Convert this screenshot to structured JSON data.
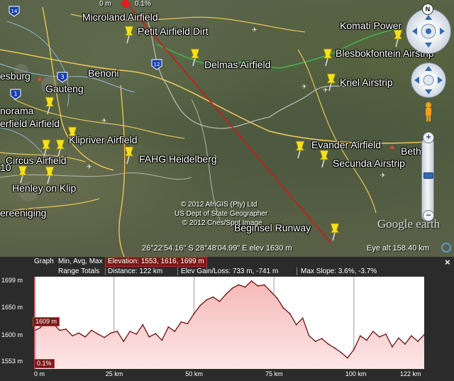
{
  "map": {
    "labels": [
      {
        "id": "microland",
        "text": "Microland Airfield"
      },
      {
        "id": "petit",
        "text": "Petit Airfield Dirt"
      },
      {
        "id": "komati",
        "text": "Komati Power"
      },
      {
        "id": "blesbok",
        "text": "Blesbokfontein Airstrip"
      },
      {
        "id": "delmas",
        "text": "Delmas Airfield"
      },
      {
        "id": "kriel",
        "text": "Kriel Airstrip"
      },
      {
        "id": "esburg",
        "text": "esburg"
      },
      {
        "id": "benoni",
        "text": "Benoni"
      },
      {
        "id": "gauteng",
        "text": "Gauteng"
      },
      {
        "id": "norama",
        "text": "norama"
      },
      {
        "id": "erfield",
        "text": "erfield Airfield"
      },
      {
        "id": "klipriver",
        "text": "Klipriver Airfield"
      },
      {
        "id": "evander",
        "text": "Evander Airfield"
      },
      {
        "id": "bethal",
        "text": "Bethal"
      },
      {
        "id": "circus",
        "text": "Circus Airfield"
      },
      {
        "id": "fahg",
        "text": "FAHG Heidelberg"
      },
      {
        "id": "secunda",
        "text": "Secunda Airstrip"
      },
      {
        "id": "ten",
        "text": "10"
      },
      {
        "id": "henley",
        "text": "Henley on Klip"
      },
      {
        "id": "ereeniging",
        "text": "ereeniging"
      },
      {
        "id": "beginsel",
        "text": "Beginsel Runway"
      }
    ],
    "shields": [
      {
        "id": "s14",
        "text": "14"
      },
      {
        "id": "s3",
        "text": "3"
      },
      {
        "id": "s12",
        "text": "12"
      },
      {
        "id": "s1",
        "text": "1"
      }
    ],
    "cursor_marker": {
      "distance": "0 m",
      "slope": "0.1%"
    },
    "copyright": [
      "© 2012 AfriGIS (Pty) Ltd",
      "US Dept of State Geographer",
      "© 2012 Cnes/Spot Image"
    ],
    "logo": "Google earth",
    "status": {
      "coords": "26°22'54.16\" S   28°48'04.99\" E  elev  1630 m",
      "eye_alt": "Eye alt   158.40 km"
    },
    "north_label": "N"
  },
  "panel": {
    "graph_label": "Graph",
    "graph_mode": "Min, Avg, Max",
    "elevation_label": "Elevation: 1553, 1616, 1699 m",
    "range_totals": "Range Totals",
    "distance": "Distance: 122 km",
    "elev_gain_loss": "Elev Gain/Loss: 733 m, -741 m",
    "max_slope": "Max Slope: 3.6%, -3.7%",
    "close": "×"
  },
  "chart_data": {
    "type": "area",
    "title": "",
    "xlabel": "",
    "ylabel": "",
    "x_unit": "km",
    "y_unit": "m",
    "xlim": [
      0,
      122
    ],
    "ylim": [
      1553,
      1699
    ],
    "y_ticks": [
      "1699 m",
      "1650 m",
      "1600 m",
      "1553 m"
    ],
    "y_tick_values": [
      1699,
      1650,
      1600,
      1553
    ],
    "x_ticks": [
      "0 m",
      "25 km",
      "50 km",
      "75 km",
      "100 km",
      "122 km"
    ],
    "x_tick_values": [
      0,
      25,
      50,
      75,
      100,
      122
    ],
    "cursor": {
      "elevation": "1609 m",
      "slope": "0.1%"
    },
    "series": [
      {
        "x": [
          0,
          2,
          4,
          6,
          8,
          10,
          12,
          14,
          16,
          18,
          20,
          22,
          24,
          26,
          28,
          30,
          32,
          34,
          36,
          38,
          40,
          42,
          44,
          46,
          48,
          50,
          52,
          54,
          56,
          58,
          60,
          62,
          64,
          66,
          68,
          70,
          72,
          74,
          76,
          78,
          80,
          82,
          84,
          86,
          88,
          90,
          92,
          94,
          96,
          98,
          100,
          102,
          104,
          106,
          108,
          110,
          112,
          114,
          116,
          118,
          120,
          122
        ],
        "values": [
          1609,
          1615,
          1628,
          1622,
          1610,
          1612,
          1600,
          1605,
          1598,
          1610,
          1603,
          1597,
          1605,
          1608,
          1590,
          1608,
          1603,
          1620,
          1598,
          1604,
          1592,
          1616,
          1608,
          1625,
          1622,
          1640,
          1655,
          1665,
          1670,
          1662,
          1675,
          1686,
          1692,
          1688,
          1699,
          1690,
          1692,
          1680,
          1668,
          1650,
          1640,
          1620,
          1632,
          1600,
          1590,
          1595,
          1585,
          1578,
          1570,
          1560,
          1575,
          1600,
          1592,
          1608,
          1598,
          1603,
          1580,
          1596,
          1585,
          1600,
          1590,
          1602
        ]
      }
    ]
  }
}
